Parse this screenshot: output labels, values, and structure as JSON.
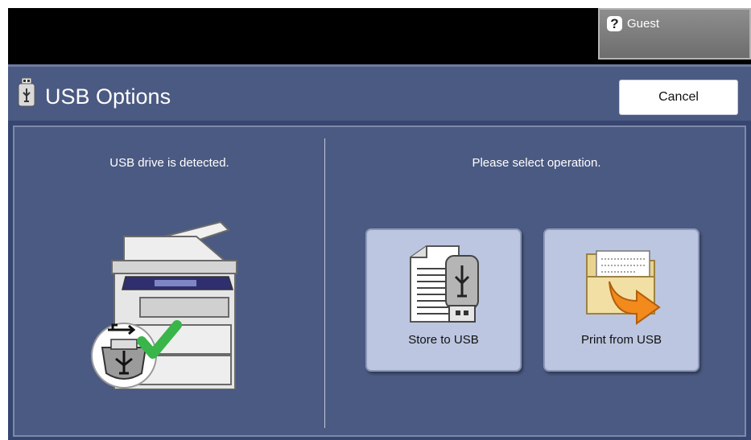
{
  "topbar": {
    "user_label": "Guest"
  },
  "header": {
    "title": "USB Options",
    "cancel_label": "Cancel"
  },
  "left": {
    "status_message": "USB drive is detected."
  },
  "right": {
    "instruction": "Please select operation.",
    "buttons": [
      {
        "label": "Store to USB",
        "icon": "store-to-usb-icon"
      },
      {
        "label": "Print from USB",
        "icon": "print-from-usb-icon"
      }
    ]
  },
  "colors": {
    "panel_dark": "#364670",
    "panel": "#4b5a82",
    "button": "#bcc6e0",
    "check": "#39b54a",
    "arrow": "#f28a1c"
  }
}
